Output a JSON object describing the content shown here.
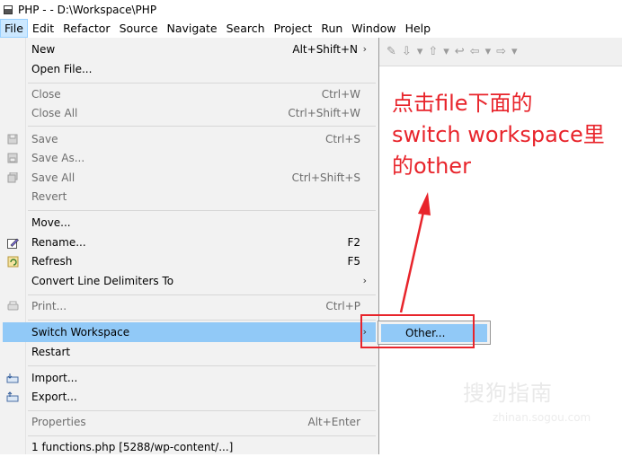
{
  "window": {
    "title": "PHP -  - D:\\Workspace\\PHP"
  },
  "menubar": [
    "File",
    "Edit",
    "Refactor",
    "Source",
    "Navigate",
    "Search",
    "Project",
    "Run",
    "Window",
    "Help"
  ],
  "file_menu": {
    "new": {
      "label": "New",
      "shortcut": "Alt+Shift+N"
    },
    "open_file": {
      "label": "Open File..."
    },
    "close": {
      "label": "Close",
      "shortcut": "Ctrl+W"
    },
    "close_all": {
      "label": "Close All",
      "shortcut": "Ctrl+Shift+W"
    },
    "save": {
      "label": "Save",
      "shortcut": "Ctrl+S"
    },
    "save_as": {
      "label": "Save As..."
    },
    "save_all": {
      "label": "Save All",
      "shortcut": "Ctrl+Shift+S"
    },
    "revert": {
      "label": "Revert"
    },
    "move": {
      "label": "Move..."
    },
    "rename": {
      "label": "Rename...",
      "shortcut": "F2"
    },
    "refresh": {
      "label": "Refresh",
      "shortcut": "F5"
    },
    "convert": {
      "label": "Convert Line Delimiters To"
    },
    "print": {
      "label": "Print...",
      "shortcut": "Ctrl+P"
    },
    "switch_workspace": {
      "label": "Switch Workspace"
    },
    "restart": {
      "label": "Restart"
    },
    "import": {
      "label": "Import..."
    },
    "export": {
      "label": "Export..."
    },
    "properties": {
      "label": "Properties",
      "shortcut": "Alt+Enter"
    },
    "recent_1": {
      "label": "1 functions.php  [5288/wp-content/...]"
    }
  },
  "submenu": {
    "other": "Other..."
  },
  "annotation": {
    "line1": "点击file下面的",
    "line2": "switch workspace里",
    "line3": "的other"
  },
  "watermark": {
    "main": "搜狗指南",
    "sub": "zhinan.sogou.com"
  },
  "colors": {
    "highlight": "#91c9f7",
    "annotation_red": "#e8242b",
    "menu_bg": "#f2f2f2"
  }
}
